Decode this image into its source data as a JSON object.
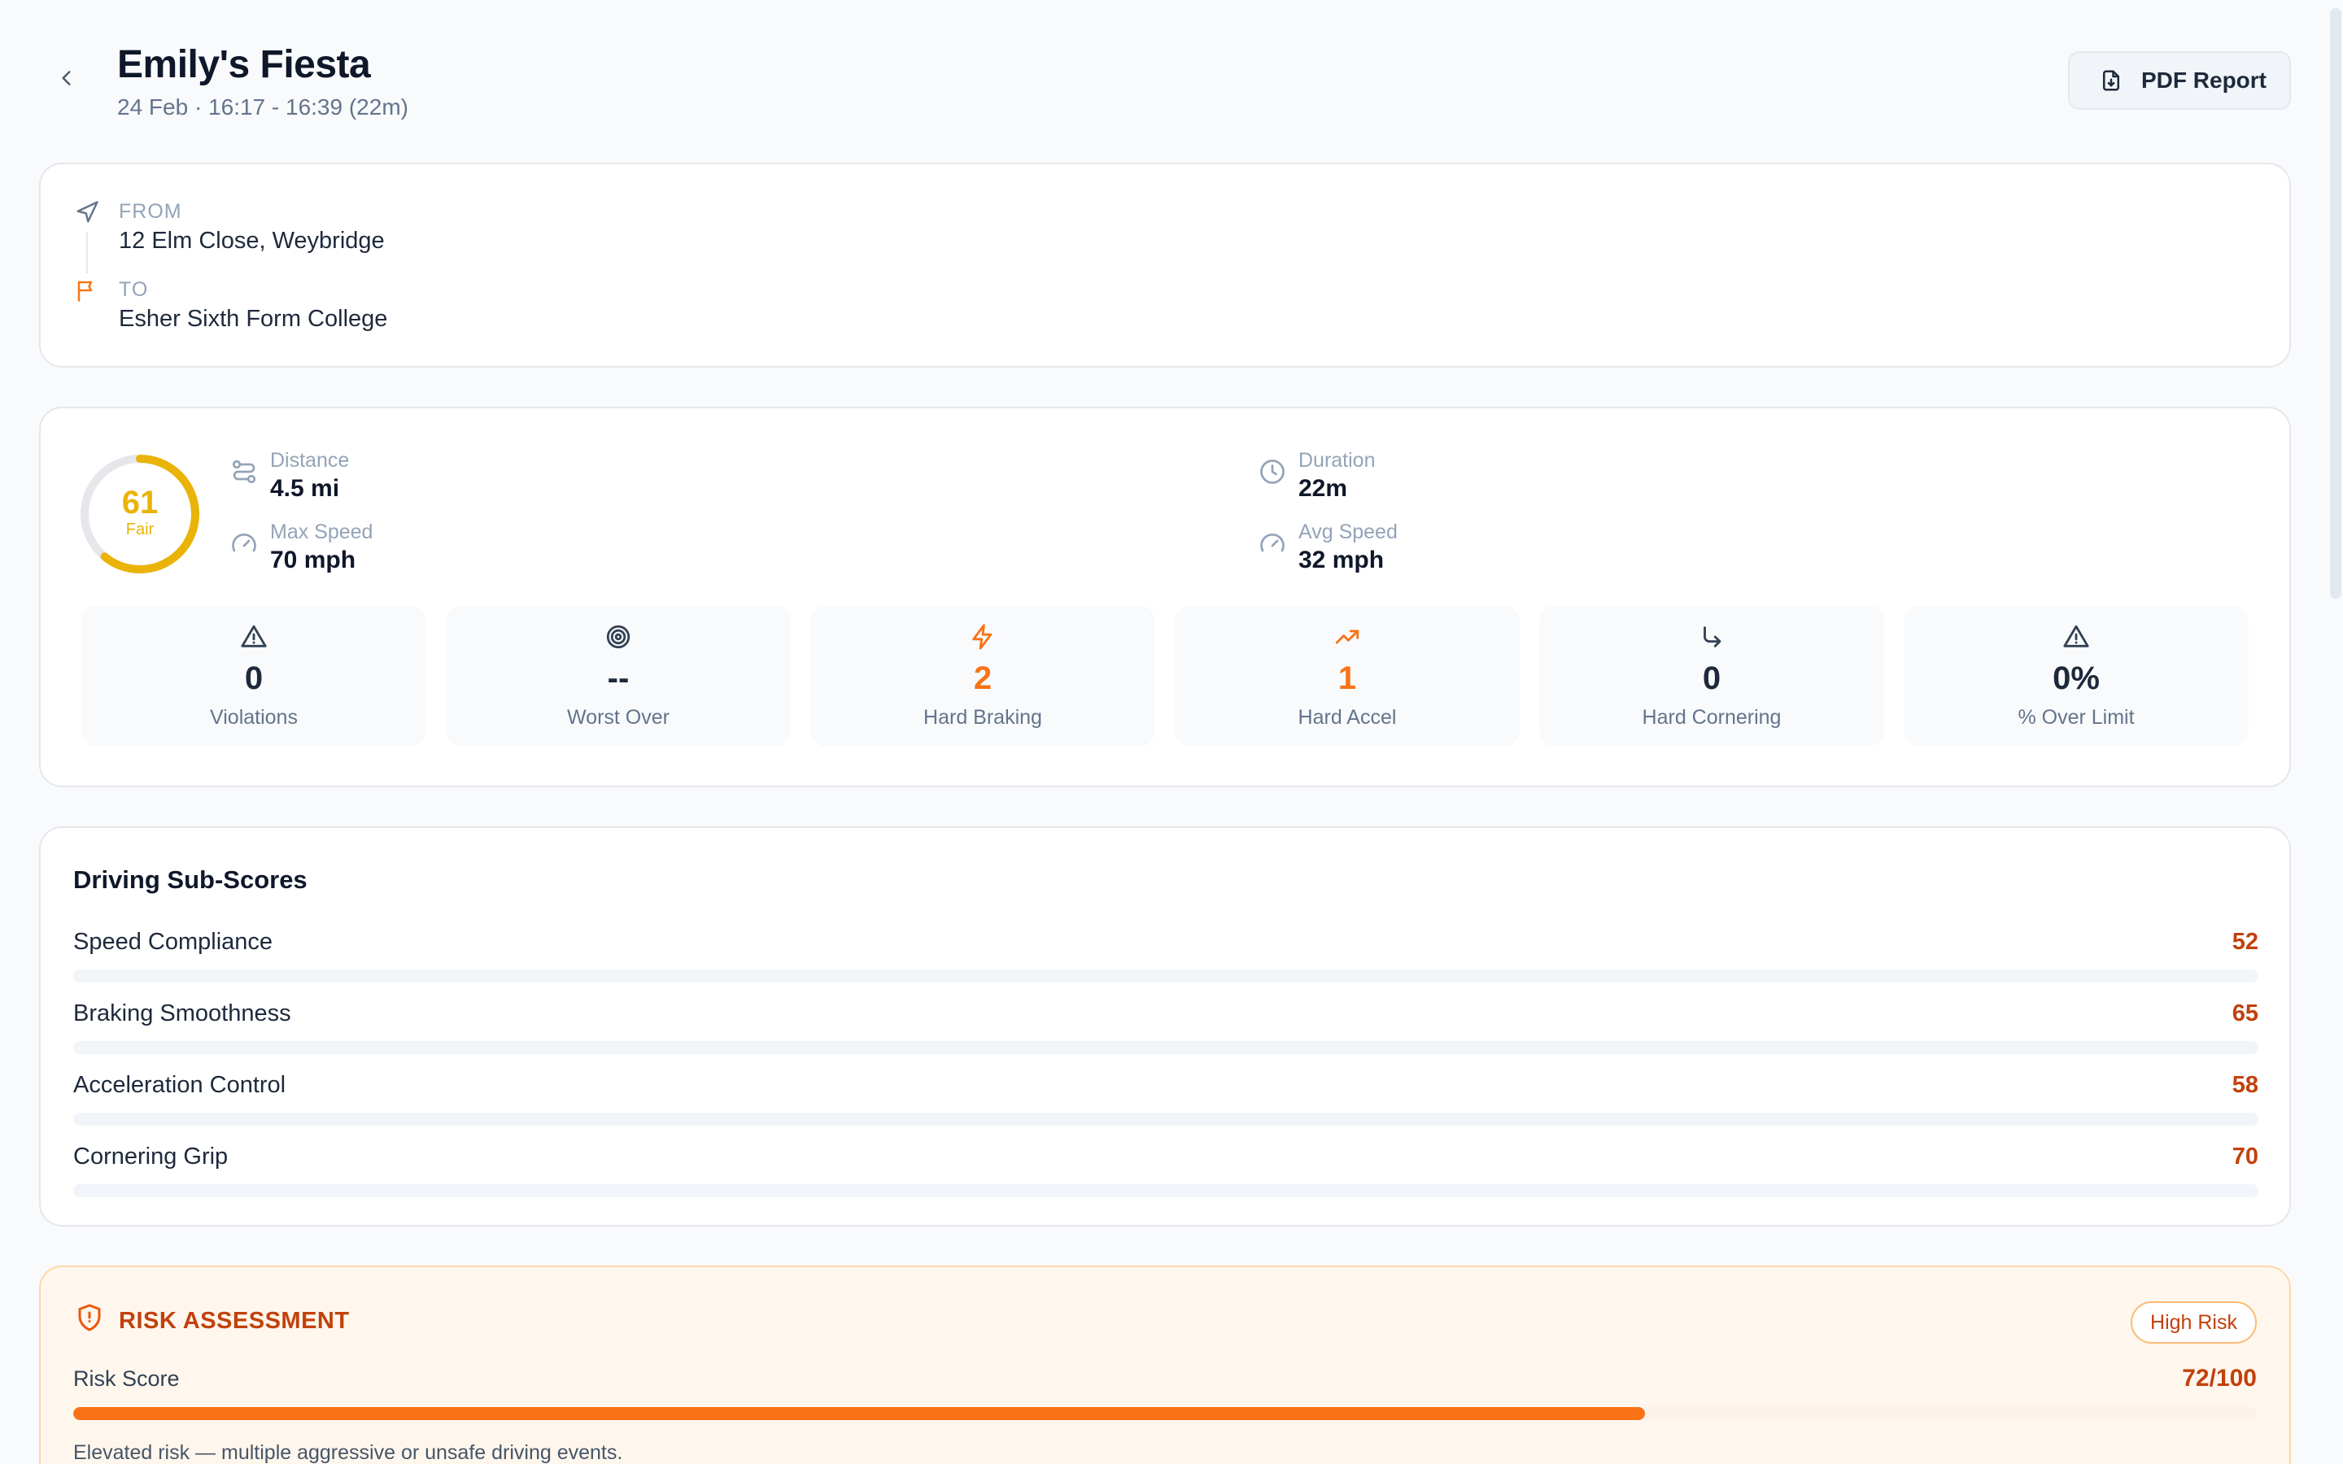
{
  "header": {
    "title": "Emily's Fiesta",
    "subtitle": "24 Feb · 16:17 - 16:39 (22m)",
    "pdf_label": "PDF Report"
  },
  "route": {
    "from_label": "FROM",
    "from_value": "12 Elm Close, Weybridge",
    "to_label": "TO",
    "to_value": "Esher Sixth Form College"
  },
  "score": {
    "value": "61",
    "label": "Fair",
    "fraction": 0.61,
    "color": "#eab308"
  },
  "metrics": [
    {
      "label": "Distance",
      "value": "4.5 mi",
      "icon": "route-icon"
    },
    {
      "label": "Duration",
      "value": "22m",
      "icon": "clock-icon"
    },
    {
      "label": "Max Speed",
      "value": "70 mph",
      "icon": "speedometer-icon"
    },
    {
      "label": "Avg Speed",
      "value": "32 mph",
      "icon": "speedometer-icon"
    }
  ],
  "tiles": [
    {
      "value": "0",
      "label": "Violations",
      "icon": "warning-triangle-icon"
    },
    {
      "value": "--",
      "label": "Worst Over",
      "icon": "target-icon"
    },
    {
      "value": "2",
      "label": "Hard Braking",
      "icon": "lightning-icon"
    },
    {
      "value": "1",
      "label": "Hard Accel",
      "icon": "trending-up-icon"
    },
    {
      "value": "0",
      "label": "Hard Cornering",
      "icon": "corner-arrow-icon"
    },
    {
      "value": "0%",
      "label": "% Over Limit",
      "icon": "warning-triangle-icon"
    }
  ],
  "subscores": {
    "title": "Driving Sub-Scores",
    "items": [
      {
        "label": "Speed Compliance",
        "value": "52"
      },
      {
        "label": "Braking Smoothness",
        "value": "65"
      },
      {
        "label": "Acceleration Control",
        "value": "58"
      },
      {
        "label": "Cornering Grip",
        "value": "70"
      }
    ]
  },
  "risk": {
    "title": "RISK ASSESSMENT",
    "badge": "High Risk",
    "score_label": "Risk Score",
    "score_value": "72/100",
    "fraction": 0.72,
    "note": "Elevated risk — multiple aggressive or unsafe driving events.",
    "accent": "#f97316"
  }
}
